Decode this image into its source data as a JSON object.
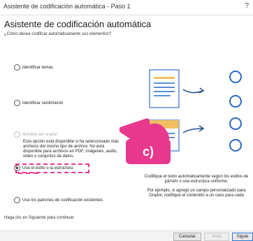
{
  "window": {
    "title": "Asistente de codificación automática - Paso 1",
    "help": "?"
  },
  "heading": "Asistente de codificación automática",
  "question": "¿Cómo desea codificar automáticamente sus elementos?",
  "options": [
    {
      "label": "Identificar temas",
      "selected": false,
      "enabled": true
    },
    {
      "label": "Identificar sentimiento",
      "selected": false,
      "enabled": true
    },
    {
      "label": "Nombre del orador",
      "selected": false,
      "enabled": false
    },
    {
      "label": "Use el estilo o la estructura",
      "selected": true,
      "enabled": true
    },
    {
      "label": "Use los patrones de codificación existentes",
      "selected": false,
      "enabled": true
    }
  ],
  "speaker_note": "Esta opción está disponible si ha seleccionado más archivos del mismo tipo de archivo. No está disponible para archivos en PDF, imágenes, audio, video o conjuntos de datos.",
  "description": "Codifique el texto automáticamente según los estilos de párrafo o una estructura uniforme.",
  "example": "Por ejemplo, si agregó un campo personalizado para Orador, codifique el contenido a un caso para cada",
  "footer_hint": "Haga clic en Siguiente para continuar",
  "buttons": {
    "cancel": "Cancelar",
    "back": "Atrás",
    "next": "Siguie"
  },
  "annotation": {
    "badge": "c)",
    "color": "#e8388e"
  },
  "icons": [
    "document-icon",
    "arrow-icon",
    "circle-node-icon",
    "pointing-hand-icon"
  ]
}
